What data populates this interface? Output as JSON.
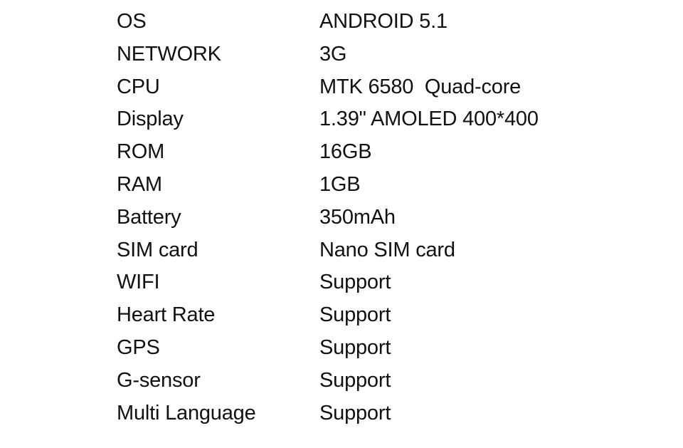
{
  "specs": [
    {
      "label": "OS",
      "value": "ANDROID 5.1"
    },
    {
      "label": "NETWORK",
      "value": "3G"
    },
    {
      "label": "CPU",
      "value": "MTK 6580  Quad-core"
    },
    {
      "label": "Display",
      "value": "1.39\" AMOLED 400*400"
    },
    {
      "label": "ROM",
      "value": "16GB"
    },
    {
      "label": "RAM",
      "value": "1GB"
    },
    {
      "label": "Battery",
      "value": "350mAh"
    },
    {
      "label": "SIM card",
      "value": "Nano SIM card"
    },
    {
      "label": "WIFI",
      "value": "Support"
    },
    {
      "label": "Heart Rate",
      "value": "Support"
    },
    {
      "label": "GPS",
      "value": "Support"
    },
    {
      "label": "G-sensor",
      "value": "Support"
    },
    {
      "label": "Multi Language",
      "value": "Support"
    }
  ]
}
